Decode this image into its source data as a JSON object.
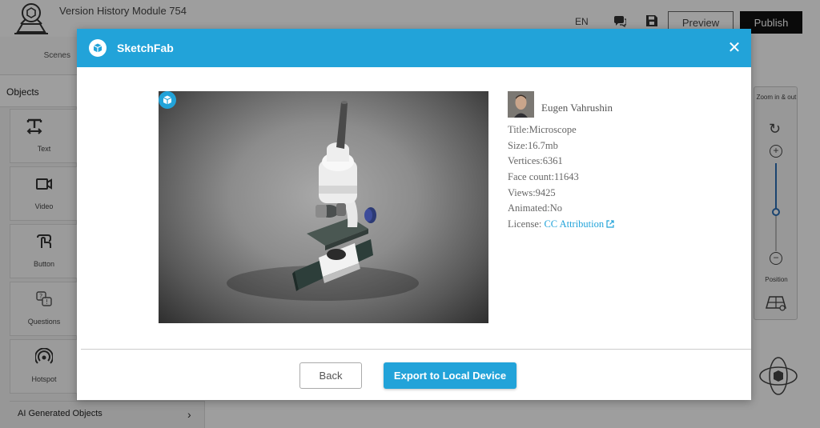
{
  "app": {
    "title": "Version History Module 754",
    "language": "EN",
    "preview_label": "Preview",
    "publish_label": "Publish"
  },
  "sidebar": {
    "scenes_label": "Scenes",
    "objects_label": "Objects",
    "tools": [
      {
        "label": "Text",
        "icon": "text-tool-icon"
      },
      {
        "label": "Video",
        "icon": "video-camera-icon"
      },
      {
        "label": "Button",
        "icon": "hand-pointer-icon"
      },
      {
        "label": "Questions",
        "icon": "questions-icon"
      },
      {
        "label": "Hotspot",
        "icon": "hotspot-icon"
      }
    ],
    "ai_generated_label": "AI Generated Objects"
  },
  "zoom_panel": {
    "title": "Zoom in & out",
    "position_label": "Position",
    "zoom_level": 0.45
  },
  "modal": {
    "title": "SketchFab",
    "close_glyph": "✕",
    "model": {
      "author": "Eugen Vahrushin",
      "title_line": "Title:Microscope",
      "size_line": "Size:16.7mb",
      "vertices_line": "Vertices:6361",
      "face_count_line": "Face count:11643",
      "views_line": "Views:9425",
      "animated_line": "Animated:No",
      "license_prefix": "License: ",
      "license_link": "CC Attribution"
    },
    "back_label": "Back",
    "export_label": "Export to Local Device"
  },
  "colors": {
    "accent": "#22a3d9",
    "publish_bg": "#111111",
    "zoom_slider": "#2a6fb5"
  }
}
